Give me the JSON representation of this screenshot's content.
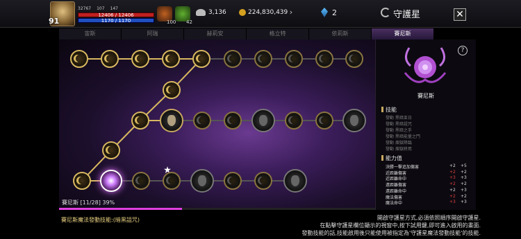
{
  "player": {
    "level": "91",
    "power": "32767",
    "stat_a": "107",
    "stat_b": "147",
    "hp": "12406 / 12406",
    "mp": "1170 / 1170"
  },
  "buffs": [
    {
      "icon": "fire-buff-icon",
      "count": "100"
    },
    {
      "icon": "leaf-buff-icon",
      "count": "42"
    }
  ],
  "currency": {
    "wings": "3,136",
    "gold": "224,830,439",
    "gems": "2"
  },
  "header": {
    "title": "守護星",
    "close": "✕"
  },
  "tabs": [
    "宙斯",
    "阿瑞",
    "赫莉安",
    "格立特",
    "依莉斯",
    "賽尼斯"
  ],
  "active_tab": 5,
  "board": {
    "progress_label": "賽尼斯 [11/28] 39%",
    "progress": 0.39
  },
  "panel": {
    "god_name": "賽尼斯",
    "skills_title": "技能",
    "skills": [
      "發動 黑暗束日",
      "發動 黑暗詛咒",
      "發動 黑暗之手",
      "發動 黑暗能量之門",
      "發動 煉獄降臨",
      "發動 煉獄終焉"
    ],
    "stats_title": "能力值",
    "stats": [
      {
        "name": "決勝一擊追加傷害",
        "current": "+2",
        "next": "+5",
        "red": false
      },
      {
        "name": "近距離傷害",
        "current": "+2",
        "next": "+2",
        "red": true
      },
      {
        "name": "近距離命中",
        "current": "+3",
        "next": "+3",
        "red": true
      },
      {
        "name": "遠距離傷害",
        "current": "+2",
        "next": "+2",
        "red": true
      },
      {
        "name": "遠距離命中",
        "current": "+2",
        "next": "+3",
        "red": false
      },
      {
        "name": "魔法傷害",
        "current": "+2",
        "next": "+2",
        "red": true
      },
      {
        "name": "魔法命中",
        "current": "+3",
        "next": "+3",
        "red": true
      }
    ]
  },
  "footer": {
    "skill_note": "賽尼斯魔法發動技能:(暗黑詛咒)",
    "help_lines": [
      "開啟守護星方式,必須依照順序開啟守護星.",
      "在點擊守護星欄位顯示的視窗中,按下試用鍵,即可進入啟用的畫面.",
      "發動技能的話,技能啟用後只能使用被指定為'守護星魔法發動技能'的技能."
    ]
  }
}
